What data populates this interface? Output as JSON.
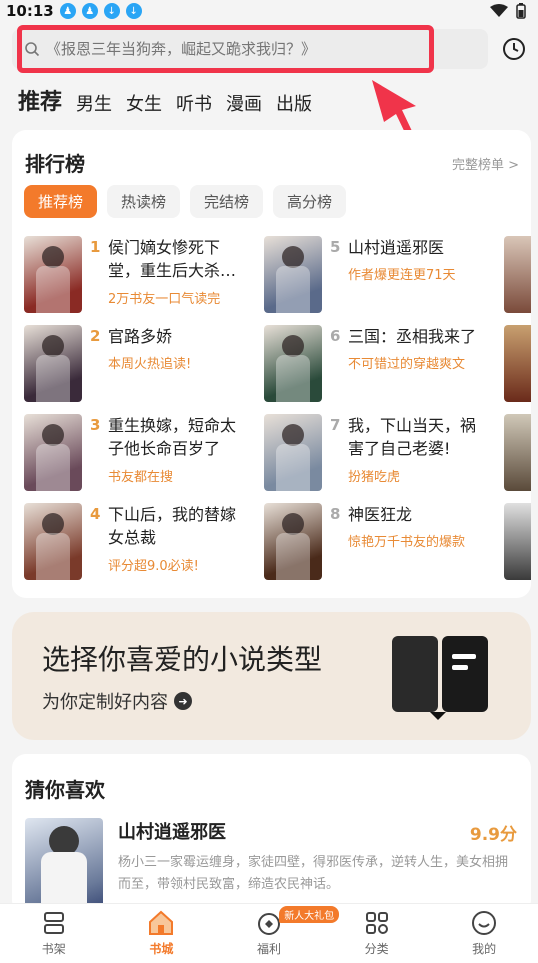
{
  "status": {
    "time": "10:13"
  },
  "search": {
    "placeholder": "《报恩三年当狗奔，崛起又跪求我归？》"
  },
  "tabs": [
    "推荐",
    "男生",
    "女生",
    "听书",
    "漫画",
    "出版"
  ],
  "ranking": {
    "title": "排行榜",
    "more": "完整榜单 >",
    "chips": [
      "推荐榜",
      "热读榜",
      "完结榜",
      "高分榜"
    ],
    "books": [
      {
        "rank": "1",
        "name": "侯门嫡女惨死下堂，重生后大杀…",
        "tag": "2万书友一口气读完",
        "cover_color": "#8a2a24"
      },
      {
        "rank": "2",
        "name": "官路多娇",
        "tag": "本周火热追读!",
        "cover_color": "#3a2a3a"
      },
      {
        "rank": "3",
        "name": "重生换嫁，短命太子他长命百岁了",
        "tag": "书友都在搜",
        "cover_color": "#6a4a5a"
      },
      {
        "rank": "4",
        "name": "下山后，我的替嫁女总裁",
        "tag": "评分超9.0必读!",
        "cover_color": "#7a3a2a"
      },
      {
        "rank": "5",
        "name": "山村逍遥邪医",
        "tag": "作者爆更连更71天",
        "cover_color": "#5a6a8a"
      },
      {
        "rank": "6",
        "name": "三国：丞相我来了",
        "tag": "不可错过的穿越爽文",
        "cover_color": "#2a4a3a"
      },
      {
        "rank": "7",
        "name": "我，下山当天，祸害了自己老婆!",
        "tag": "扮猪吃虎",
        "cover_color": "#7a8aa0"
      },
      {
        "rank": "8",
        "name": "神医狂龙",
        "tag": "惊艳万千书友的爆款",
        "cover_color": "#4a2a1a"
      }
    ]
  },
  "genre_banner": {
    "title": "选择你喜爱的小说类型",
    "subtitle": "为你定制好内容"
  },
  "guess": {
    "title": "猜你喜欢",
    "book": {
      "name": "山村逍遥邪医",
      "score": "9.9分",
      "desc": "杨小三一家霉运缠身，家徒四壁，得邪医传承，逆转人生，美女相拥而至，带领村民致富，缔造农民神话。"
    }
  },
  "nav": {
    "items": [
      "书架",
      "书城",
      "福利",
      "分类",
      "我的"
    ],
    "badge": "新人大礼包",
    "active": "书城"
  }
}
